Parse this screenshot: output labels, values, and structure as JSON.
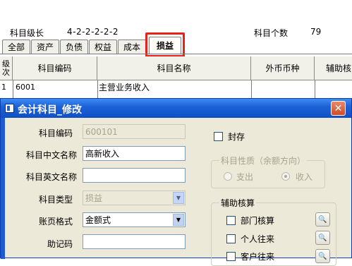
{
  "header": {
    "level_label": "科目级长",
    "level_value": "4-2-2-2-2-2",
    "count_label": "科目个数",
    "count_value": "79"
  },
  "tabs": [
    {
      "label": "全部",
      "active": false
    },
    {
      "label": "资产",
      "active": false
    },
    {
      "label": "负债",
      "active": false
    },
    {
      "label": "权益",
      "active": false
    },
    {
      "label": "成本",
      "active": false
    },
    {
      "label": "损益",
      "active": true
    }
  ],
  "grid": {
    "columns": [
      "级\n次",
      "科目编码",
      "科目名称",
      "外币币种",
      "辅助核"
    ],
    "rows": [
      {
        "level": "1",
        "code": "6001",
        "name": "主营业务收入",
        "currency": "",
        "aux": ""
      }
    ]
  },
  "dialog": {
    "title": "会计科目_修改",
    "close_glyph": "✕",
    "fields": {
      "code_label": "科目编码",
      "code_value": "600101",
      "cn_name_label": "科目中文名称",
      "cn_name_value": "高新收入",
      "en_name_label": "科目英文名称",
      "en_name_value": "",
      "type_label": "科目类型",
      "type_value": "损益",
      "format_label": "账页格式",
      "format_value": "金额式",
      "mnemonic_label": "助记码",
      "mnemonic_value": ""
    },
    "seal_label": "封存",
    "nature_group": {
      "title": "科目性质（余额方向）",
      "debit": "支出",
      "credit": "收入",
      "selected": "收入"
    },
    "aux_group": {
      "title": "辅助核算",
      "items": [
        "部门核算",
        "个人往来",
        "客户往来"
      ]
    }
  },
  "colors": {
    "highlight": "#e8211c",
    "titlebar": "#1e62d8",
    "dialog_bg": "#ece9d8"
  }
}
